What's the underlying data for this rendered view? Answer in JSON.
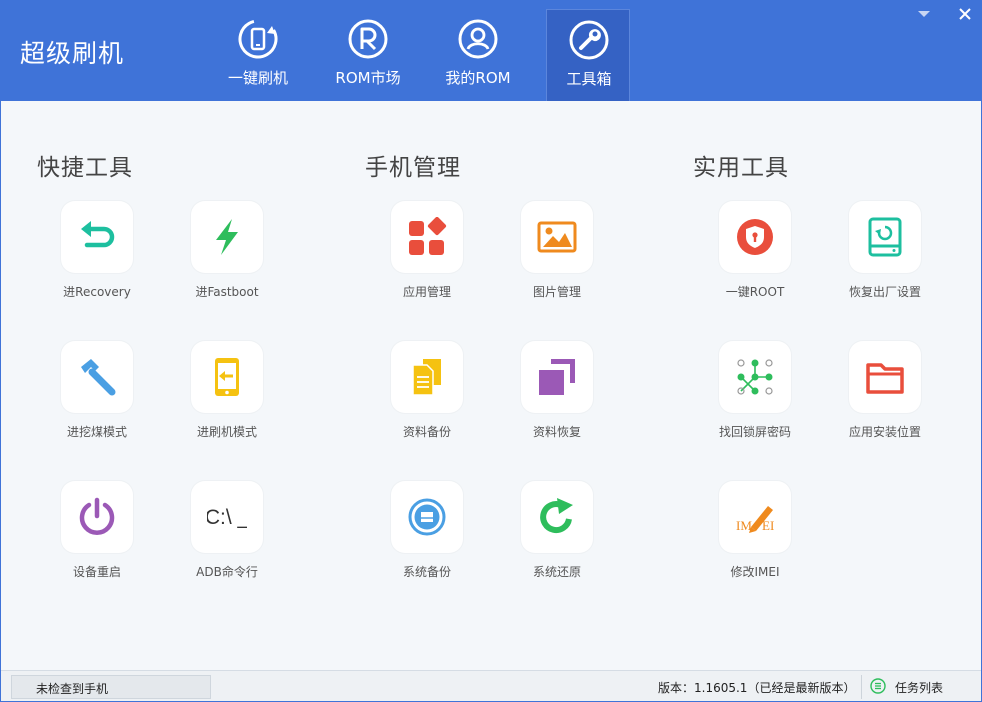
{
  "app": {
    "title": "超级刷机"
  },
  "nav": {
    "tabs": [
      {
        "label": "一键刷机",
        "icon": "phone-refresh-icon"
      },
      {
        "label": "ROM市场",
        "icon": "rom-market-icon"
      },
      {
        "label": "我的ROM",
        "icon": "user-icon"
      },
      {
        "label": "工具箱",
        "icon": "wrench-icon",
        "active": true
      }
    ]
  },
  "sections": [
    {
      "title": "快捷工具",
      "tools": [
        {
          "label": "进Recovery",
          "icon": "return-arrow-icon"
        },
        {
          "label": "进Fastboot",
          "icon": "lightning-icon"
        },
        {
          "label": "进挖煤模式",
          "icon": "hammer-icon"
        },
        {
          "label": "进刷机模式",
          "icon": "phone-arrow-icon"
        },
        {
          "label": "设备重启",
          "icon": "power-icon"
        },
        {
          "label": "ADB命令行",
          "icon": "command-line-icon",
          "icon_text": "C:\\ _"
        }
      ]
    },
    {
      "title": "手机管理",
      "tools": [
        {
          "label": "应用管理",
          "icon": "app-grid-icon"
        },
        {
          "label": "图片管理",
          "icon": "picture-icon"
        },
        {
          "label": "资料备份",
          "icon": "document-backup-icon"
        },
        {
          "label": "资料恢复",
          "icon": "restore-squares-icon"
        },
        {
          "label": "系统备份",
          "icon": "disk-backup-icon"
        },
        {
          "label": "系统还原",
          "icon": "refresh-arrow-icon"
        }
      ]
    },
    {
      "title": "实用工具",
      "tools": [
        {
          "label": "一键ROOT",
          "icon": "shield-lock-icon"
        },
        {
          "label": "恢复出厂设置",
          "icon": "factory-reset-icon"
        },
        {
          "label": "找回锁屏密码",
          "icon": "pattern-lock-icon"
        },
        {
          "label": "应用安装位置",
          "icon": "folder-icon"
        },
        {
          "label": "修改IMEI",
          "icon": "imei-pen-icon",
          "icon_text_left": "IM",
          "icon_text_right": "EI"
        }
      ]
    }
  ],
  "status": {
    "device": "未检查到手机",
    "version": "版本：1.1605.1（已经是最新版本）",
    "task_list": "任务列表"
  },
  "colors": {
    "header": "#3f73d8",
    "teal": "#1dbf9f",
    "green": "#2ebd5c",
    "blue": "#4a9fe3",
    "yellow": "#f5c211",
    "purple": "#9b59b6",
    "red": "#e94e3c",
    "orange": "#ef8a1e"
  }
}
